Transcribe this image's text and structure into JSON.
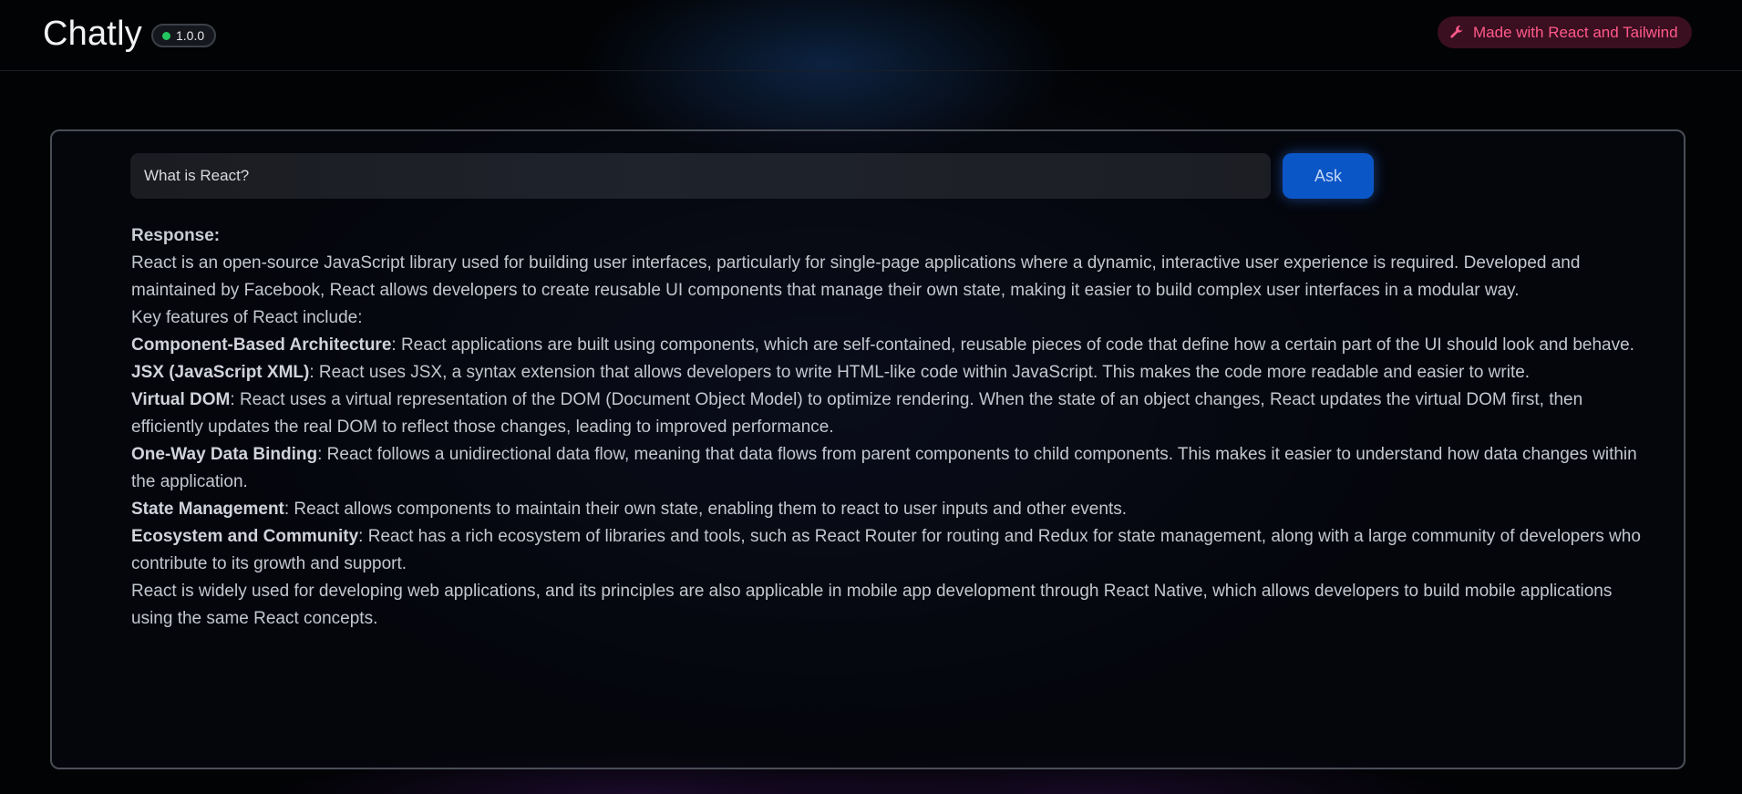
{
  "header": {
    "brand": "Chatly",
    "version": "1.0.0",
    "made_with": "Made with React and Tailwind"
  },
  "query": {
    "value": "What is React?",
    "ask_label": "Ask"
  },
  "response": {
    "label": "Response:",
    "intro": "React is an open-source JavaScript library used for building user interfaces, particularly for single-page applications where a dynamic, interactive user experience is required. Developed and maintained by Facebook, React allows developers to create reusable UI components that manage their own state, making it easier to build complex user interfaces in a modular way.",
    "features_heading": "Key features of React include:",
    "features": [
      {
        "title": "Component-Based Architecture",
        "text": ": React applications are built using components, which are self-contained, reusable pieces of code that define how a certain part of the UI should look and behave."
      },
      {
        "title": "JSX (JavaScript XML)",
        "text": ": React uses JSX, a syntax extension that allows developers to write HTML-like code within JavaScript. This makes the code more readable and easier to write."
      },
      {
        "title": "Virtual DOM",
        "text": ": React uses a virtual representation of the DOM (Document Object Model) to optimize rendering. When the state of an object changes, React updates the virtual DOM first, then efficiently updates the real DOM to reflect those changes, leading to improved performance."
      },
      {
        "title": "One-Way Data Binding",
        "text": ": React follows a unidirectional data flow, meaning that data flows from parent components to child components. This makes it easier to understand how data changes within the application."
      },
      {
        "title": "State Management",
        "text": ": React allows components to maintain their own state, enabling them to react to user inputs and other events."
      },
      {
        "title": "Ecosystem and Community",
        "text": ": React has a rich ecosystem of libraries and tools, such as React Router for routing and Redux for state management, along with a large community of developers who contribute to its growth and support."
      }
    ],
    "conclusion": "React is widely used for developing web applications, and its principles are also applicable in mobile app development through React Native, which allows developers to build mobile applications using the same React concepts."
  },
  "colors": {
    "accent": "#0b56c7",
    "badge_dot": "#22c55e",
    "made_with_text": "#ff5a8a"
  },
  "icons": [
    "status-dot-icon",
    "wrench-icon"
  ]
}
